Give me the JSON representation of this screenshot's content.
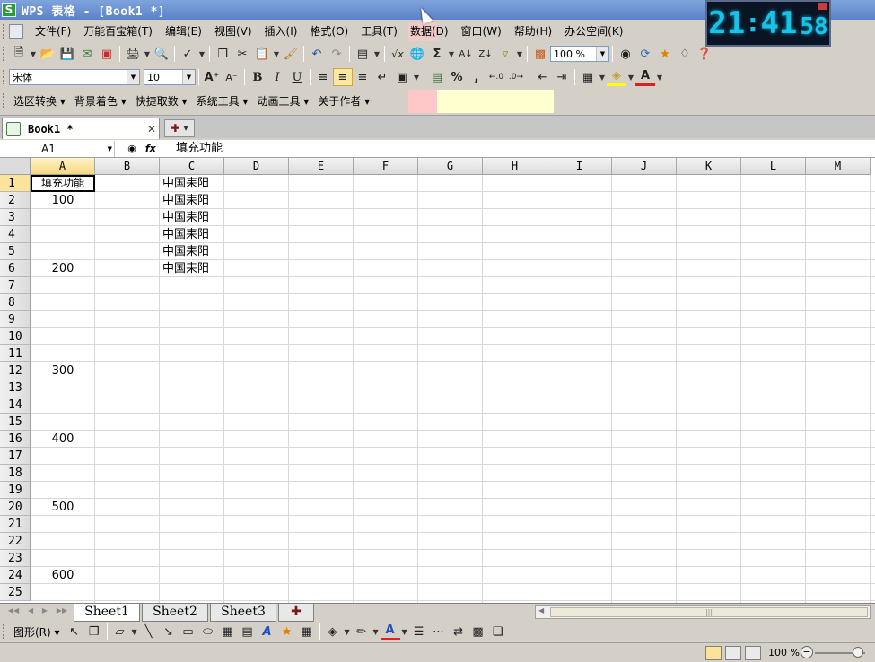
{
  "window": {
    "title": "WPS 表格 - [Book1 *]",
    "logo": "S"
  },
  "clock": {
    "h": "21",
    "m": "41",
    "s": "58"
  },
  "menu": [
    "文件(F)",
    "万能百宝箱(T)",
    "编辑(E)",
    "视图(V)",
    "插入(I)",
    "格式(O)",
    "工具(T)",
    "数据(D)",
    "窗口(W)",
    "帮助(H)",
    "办公空间(K)"
  ],
  "toolbar": {
    "zoom": "100 %"
  },
  "format": {
    "font": "宋体",
    "size": "10",
    "bold": "B",
    "italic": "I",
    "underline": "U",
    "percent": "%",
    "comma": ","
  },
  "custom_toolbar": [
    "选区转换",
    "背景着色",
    "快捷取数",
    "系统工具",
    "动画工具",
    "关于作者"
  ],
  "doc_tab": {
    "label": "Book1 *"
  },
  "formula_bar": {
    "name_box": "A1",
    "formula": "填充功能"
  },
  "columns": [
    "A",
    "B",
    "C",
    "D",
    "E",
    "F",
    "G",
    "H",
    "I",
    "J",
    "K",
    "L",
    "M"
  ],
  "rows": [
    "1",
    "2",
    "3",
    "4",
    "5",
    "6",
    "7",
    "8",
    "9",
    "10",
    "11",
    "12",
    "13",
    "14",
    "15",
    "16",
    "17",
    "18",
    "19",
    "20",
    "21",
    "22",
    "23",
    "24",
    "25"
  ],
  "cells": {
    "A1": "填充功能",
    "A2": "100",
    "A6": "200",
    "A12": "300",
    "A16": "400",
    "A20": "500",
    "A24": "600",
    "C1": "中国耒阳",
    "C2": "中国耒阳",
    "C3": "中国耒阳",
    "C4": "中国耒阳",
    "C5": "中国耒阳",
    "C6": "中国耒阳"
  },
  "sheets": [
    "Sheet1",
    "Sheet2",
    "Sheet3"
  ],
  "draw_toolbar": {
    "label": "图形(R)"
  },
  "status": {
    "zoom": "100 %"
  }
}
